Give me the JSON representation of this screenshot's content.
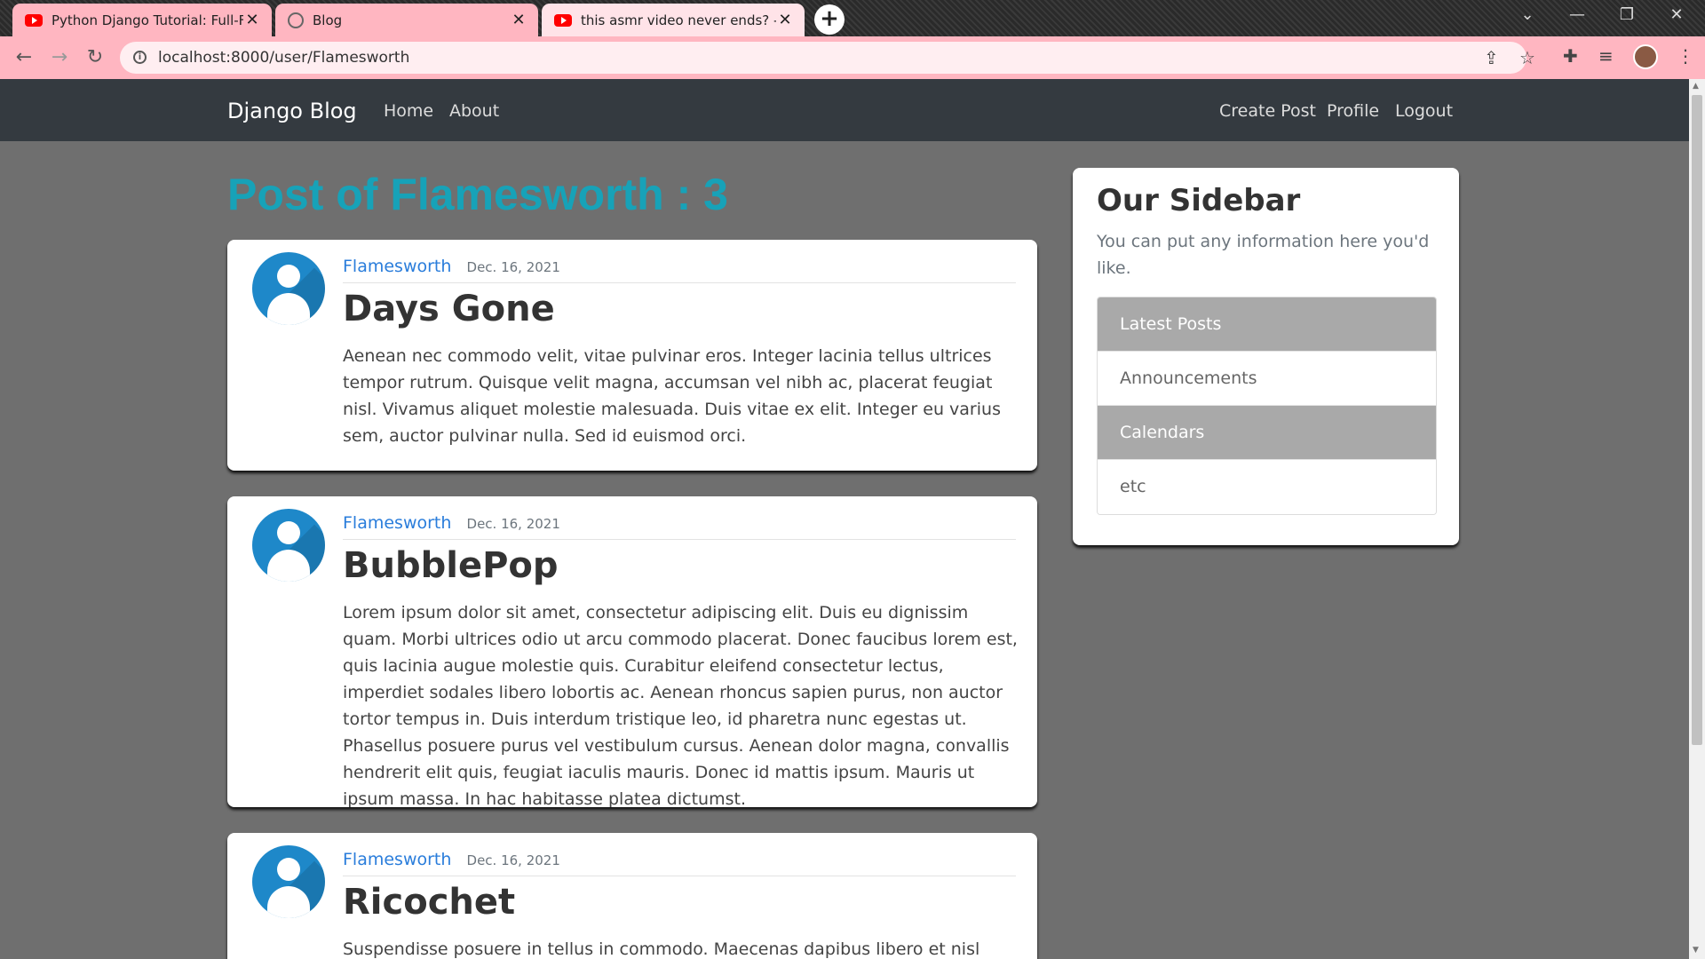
{
  "browser": {
    "tabs": [
      {
        "title": "Python Django Tutorial: Full-Feat",
        "icon": "youtube-icon"
      },
      {
        "title": "Blog",
        "icon": "globe-icon"
      },
      {
        "title": "this asmr video never ends? - You",
        "icon": "youtube-icon"
      }
    ],
    "new_tab_label": "+",
    "url": "localhost:8000/user/Flamesworth",
    "accent_color": "#ffb6c1"
  },
  "navbar": {
    "brand": "Django Blog",
    "left_links": [
      "Home",
      "About"
    ],
    "right_links": [
      "Create Post",
      "Profile",
      "Logout"
    ]
  },
  "main": {
    "title": "Post of Flamesworth : 3",
    "posts": [
      {
        "author": "Flamesworth",
        "date": "Dec. 16, 2021",
        "title": "Days Gone",
        "content": "Aenean nec commodo velit, vitae pulvinar eros. Integer lacinia tellus ultrices tempor rutrum. Quisque velit magna, accumsan vel nibh ac, placerat feugiat nisl. Vivamus aliquet molestie malesuada. Duis vitae ex elit. Integer eu varius sem, auctor pulvinar nulla. Sed id euismod orci."
      },
      {
        "author": "Flamesworth",
        "date": "Dec. 16, 2021",
        "title": "BubblePop",
        "content": "Lorem ipsum dolor sit amet, consectetur adipiscing elit. Duis eu dignissim quam. Morbi ultrices odio ut arcu commodo placerat. Donec faucibus lorem est, quis lacinia augue molestie quis. Curabitur eleifend consectetur lectus, imperdiet sodales libero lobortis ac. Aenean rhoncus sapien purus, non auctor tortor tempus in. Duis interdum tristique leo, id pharetra nunc egestas ut. Phasellus posuere purus vel vestibulum cursus. Aenean dolor magna, convallis hendrerit elit quis, feugiat iaculis mauris. Donec id mattis ipsum. Mauris ut ipsum massa. In hac habitasse platea dictumst."
      },
      {
        "author": "Flamesworth",
        "date": "Dec. 16, 2021",
        "title": "Ricochet",
        "content": "Suspendisse posuere in tellus in commodo. Maecenas dapibus libero et nisl mattis,"
      }
    ]
  },
  "sidebar": {
    "title": "Our Sidebar",
    "description": "You can put any information here you'd like.",
    "items": [
      "Latest Posts",
      "Announcements",
      "Calendars",
      "etc"
    ]
  }
}
